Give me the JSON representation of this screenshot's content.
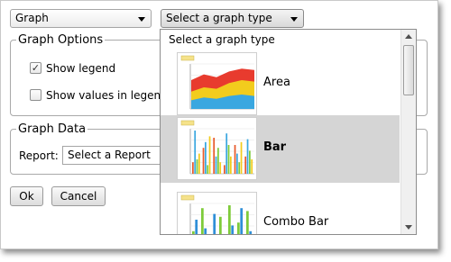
{
  "graph_select": {
    "value": "Graph"
  },
  "type_select": {
    "value": "Select a graph type",
    "options": [
      {
        "label": "Area"
      },
      {
        "label": "Bar"
      },
      {
        "label": "Combo Bar"
      }
    ],
    "selected_option": "Bar"
  },
  "options_group": {
    "legend": "Graph Options",
    "show_legend": {
      "label": "Show legend",
      "checked": true
    },
    "show_values": {
      "label": "Show values in legend",
      "checked": false
    }
  },
  "data_group": {
    "legend": "Graph Data",
    "report_label": "Report:",
    "report_select": {
      "value": "Select a Report"
    }
  },
  "buttons": {
    "ok": "Ok",
    "cancel": "Cancel"
  },
  "thumb_charts": {
    "area": {
      "series": [
        [
          20,
          24,
          22,
          26,
          28,
          27
        ],
        [
          12,
          15,
          14,
          18,
          20,
          19
        ],
        [
          6,
          8,
          7,
          9,
          10,
          9
        ]
      ],
      "colors": [
        "#e83b2e",
        "#f2cc1d",
        "#3aa7e0"
      ]
    },
    "bar": {
      "values": [
        [
          8,
          18,
          25,
          6,
          20,
          12
        ],
        [
          30,
          22,
          12,
          28,
          14,
          24
        ],
        [
          10,
          6,
          18,
          20,
          8,
          16
        ],
        [
          14,
          26,
          8,
          12,
          22,
          10
        ]
      ],
      "colors": [
        "#e85a2b",
        "#3aa7e0",
        "#7ecb3a",
        "#f2cc1d"
      ]
    },
    "combo": {
      "values": [
        [
          12,
          28,
          8,
          22,
          30,
          18,
          26
        ],
        [
          20,
          14,
          24,
          10,
          16,
          28,
          12
        ]
      ],
      "colors": [
        "#7ecb3a",
        "#2f8fd8"
      ]
    }
  }
}
